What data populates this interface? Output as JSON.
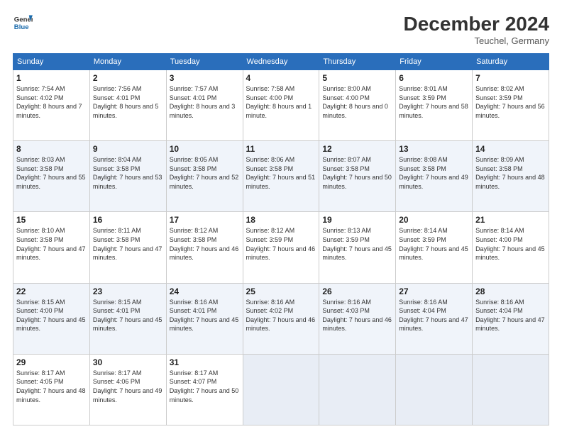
{
  "header": {
    "logo_line1": "General",
    "logo_line2": "Blue",
    "month_title": "December 2024",
    "location": "Teuchel, Germany"
  },
  "weekdays": [
    "Sunday",
    "Monday",
    "Tuesday",
    "Wednesday",
    "Thursday",
    "Friday",
    "Saturday"
  ],
  "weeks": [
    [
      {
        "day": "1",
        "sunrise": "7:54 AM",
        "sunset": "4:02 PM",
        "daylight": "8 hours and 7 minutes."
      },
      {
        "day": "2",
        "sunrise": "7:56 AM",
        "sunset": "4:01 PM",
        "daylight": "8 hours and 5 minutes."
      },
      {
        "day": "3",
        "sunrise": "7:57 AM",
        "sunset": "4:01 PM",
        "daylight": "8 hours and 3 minutes."
      },
      {
        "day": "4",
        "sunrise": "7:58 AM",
        "sunset": "4:00 PM",
        "daylight": "8 hours and 1 minute."
      },
      {
        "day": "5",
        "sunrise": "8:00 AM",
        "sunset": "4:00 PM",
        "daylight": "8 hours and 0 minutes."
      },
      {
        "day": "6",
        "sunrise": "8:01 AM",
        "sunset": "3:59 PM",
        "daylight": "7 hours and 58 minutes."
      },
      {
        "day": "7",
        "sunrise": "8:02 AM",
        "sunset": "3:59 PM",
        "daylight": "7 hours and 56 minutes."
      }
    ],
    [
      {
        "day": "8",
        "sunrise": "8:03 AM",
        "sunset": "3:58 PM",
        "daylight": "7 hours and 55 minutes."
      },
      {
        "day": "9",
        "sunrise": "8:04 AM",
        "sunset": "3:58 PM",
        "daylight": "7 hours and 53 minutes."
      },
      {
        "day": "10",
        "sunrise": "8:05 AM",
        "sunset": "3:58 PM",
        "daylight": "7 hours and 52 minutes."
      },
      {
        "day": "11",
        "sunrise": "8:06 AM",
        "sunset": "3:58 PM",
        "daylight": "7 hours and 51 minutes."
      },
      {
        "day": "12",
        "sunrise": "8:07 AM",
        "sunset": "3:58 PM",
        "daylight": "7 hours and 50 minutes."
      },
      {
        "day": "13",
        "sunrise": "8:08 AM",
        "sunset": "3:58 PM",
        "daylight": "7 hours and 49 minutes."
      },
      {
        "day": "14",
        "sunrise": "8:09 AM",
        "sunset": "3:58 PM",
        "daylight": "7 hours and 48 minutes."
      }
    ],
    [
      {
        "day": "15",
        "sunrise": "8:10 AM",
        "sunset": "3:58 PM",
        "daylight": "7 hours and 47 minutes."
      },
      {
        "day": "16",
        "sunrise": "8:11 AM",
        "sunset": "3:58 PM",
        "daylight": "7 hours and 47 minutes."
      },
      {
        "day": "17",
        "sunrise": "8:12 AM",
        "sunset": "3:58 PM",
        "daylight": "7 hours and 46 minutes."
      },
      {
        "day": "18",
        "sunrise": "8:12 AM",
        "sunset": "3:59 PM",
        "daylight": "7 hours and 46 minutes."
      },
      {
        "day": "19",
        "sunrise": "8:13 AM",
        "sunset": "3:59 PM",
        "daylight": "7 hours and 45 minutes."
      },
      {
        "day": "20",
        "sunrise": "8:14 AM",
        "sunset": "3:59 PM",
        "daylight": "7 hours and 45 minutes."
      },
      {
        "day": "21",
        "sunrise": "8:14 AM",
        "sunset": "4:00 PM",
        "daylight": "7 hours and 45 minutes."
      }
    ],
    [
      {
        "day": "22",
        "sunrise": "8:15 AM",
        "sunset": "4:00 PM",
        "daylight": "7 hours and 45 minutes."
      },
      {
        "day": "23",
        "sunrise": "8:15 AM",
        "sunset": "4:01 PM",
        "daylight": "7 hours and 45 minutes."
      },
      {
        "day": "24",
        "sunrise": "8:16 AM",
        "sunset": "4:01 PM",
        "daylight": "7 hours and 45 minutes."
      },
      {
        "day": "25",
        "sunrise": "8:16 AM",
        "sunset": "4:02 PM",
        "daylight": "7 hours and 46 minutes."
      },
      {
        "day": "26",
        "sunrise": "8:16 AM",
        "sunset": "4:03 PM",
        "daylight": "7 hours and 46 minutes."
      },
      {
        "day": "27",
        "sunrise": "8:16 AM",
        "sunset": "4:04 PM",
        "daylight": "7 hours and 47 minutes."
      },
      {
        "day": "28",
        "sunrise": "8:16 AM",
        "sunset": "4:04 PM",
        "daylight": "7 hours and 47 minutes."
      }
    ],
    [
      {
        "day": "29",
        "sunrise": "8:17 AM",
        "sunset": "4:05 PM",
        "daylight": "7 hours and 48 minutes."
      },
      {
        "day": "30",
        "sunrise": "8:17 AM",
        "sunset": "4:06 PM",
        "daylight": "7 hours and 49 minutes."
      },
      {
        "day": "31",
        "sunrise": "8:17 AM",
        "sunset": "4:07 PM",
        "daylight": "7 hours and 50 minutes."
      },
      null,
      null,
      null,
      null
    ]
  ]
}
